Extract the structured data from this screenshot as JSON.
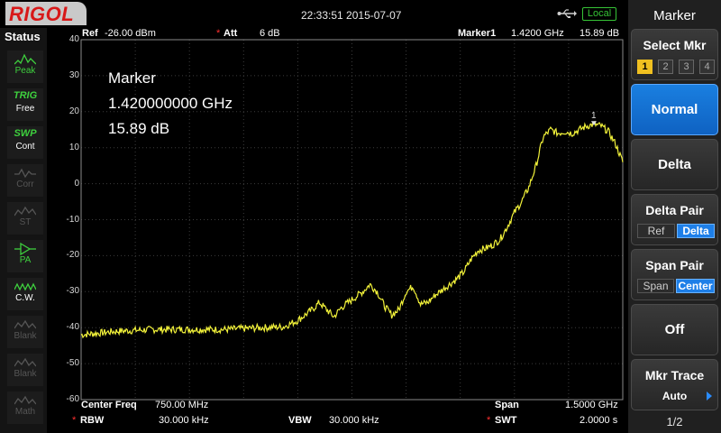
{
  "topbar": {
    "brand": "RIGOL",
    "datetime": "22:33:51  2015-07-07",
    "usb_icon": "usb-icon",
    "local_label": "Local",
    "local_color": "#36c436"
  },
  "status": {
    "title": "Status",
    "items": [
      {
        "glyph": "",
        "label": "Peak",
        "icon": "peak-icon",
        "state": "on"
      },
      {
        "glyph": "TRIG",
        "label": "Free",
        "icon": "",
        "state": "on"
      },
      {
        "glyph": "SWP",
        "label": "Cont",
        "icon": "",
        "state": "on"
      },
      {
        "glyph": "",
        "label": "Corr",
        "icon": "corr-icon",
        "state": "off"
      },
      {
        "glyph": "",
        "label": "ST",
        "icon": "st-icon",
        "state": "off"
      },
      {
        "glyph": "",
        "label": "PA",
        "icon": "pa-icon",
        "state": "on"
      },
      {
        "glyph": "",
        "label": "C.W.",
        "icon": "cw-icon",
        "state": "on"
      },
      {
        "glyph": "",
        "label": "Blank",
        "icon": "blank-icon",
        "state": "off"
      },
      {
        "glyph": "",
        "label": "Blank",
        "icon": "blank-icon",
        "state": "off"
      },
      {
        "glyph": "",
        "label": "Math",
        "icon": "math-icon",
        "state": "off"
      }
    ]
  },
  "header": {
    "ref_label": "Ref",
    "ref_value": "-26.00 dBm",
    "att_star": "*",
    "att_label": "Att",
    "att_value": "6 dB",
    "marker_label": "Marker1",
    "marker_freq": "1.4200 GHz",
    "marker_amp": "15.89 dB"
  },
  "marker_readout": {
    "title": "Marker",
    "freq": "1.420000000 GHz",
    "amp": "15.89 dB"
  },
  "footer": {
    "center_label": "Center Freq",
    "center_value": "750.00 MHz",
    "span_label": "Span",
    "span_value": "1.5000 GHz",
    "rbw_star": "*",
    "rbw_label": "RBW",
    "rbw_value": "30.000 kHz",
    "vbw_label": "VBW",
    "vbw_value": "30.000 kHz",
    "swt_star": "*",
    "swt_label": "SWT",
    "swt_value": "2.0000 s"
  },
  "menu": {
    "title": "Marker",
    "select_mkr_label": "Select Mkr",
    "mkr_numbers": [
      "1",
      "2",
      "3",
      "4"
    ],
    "mkr_active": "1",
    "normal_label": "Normal",
    "delta_label": "Delta",
    "delta_pair_label": "Delta Pair",
    "delta_pair_ref": "Ref",
    "delta_pair_delta": "Delta",
    "span_pair_label": "Span Pair",
    "span_pair_span": "Span",
    "span_pair_center": "Center",
    "off_label": "Off",
    "mkr_trace_label": "Mkr Trace",
    "mkr_trace_value": "Auto",
    "page": "1/2",
    "accent": "#1e7fe8"
  },
  "chart_data": {
    "type": "line",
    "ylim": [
      -60,
      40
    ],
    "yticks": [
      "40",
      "30",
      "20",
      "10",
      "0",
      "-10",
      "-20",
      "-30",
      "-40",
      "-50",
      "-60"
    ],
    "x_range_ghz": [
      0.0,
      1.5
    ],
    "grid": true,
    "trace_color": "#f2f23a",
    "marker": {
      "label": "1",
      "x": 1.42,
      "y": 15.89
    },
    "series": [
      {
        "x": [
          0.0,
          0.05,
          0.1,
          0.2,
          0.3,
          0.4,
          0.5,
          0.56,
          0.6,
          0.62,
          0.64,
          0.66,
          0.7,
          0.72,
          0.74,
          0.76,
          0.78,
          0.8,
          0.82,
          0.84,
          0.86,
          0.88,
          0.9,
          0.92,
          0.94,
          0.96,
          0.98,
          1.0,
          1.02,
          1.04,
          1.06,
          1.08,
          1.1,
          1.12,
          1.14,
          1.16,
          1.18,
          1.2,
          1.22,
          1.24,
          1.26,
          1.28,
          1.3,
          1.32,
          1.34,
          1.36,
          1.38,
          1.4,
          1.42,
          1.44,
          1.46,
          1.48,
          1.5
        ],
        "y": [
          -42,
          -41.5,
          -41,
          -40.5,
          -40.5,
          -40.5,
          -40,
          -39.8,
          -38,
          -36.5,
          -35,
          -33,
          -37,
          -34.5,
          -33,
          -31.5,
          -30,
          -28,
          -30,
          -34,
          -36.5,
          -35,
          -30,
          -28.5,
          -33.5,
          -33,
          -31,
          -29.5,
          -28,
          -26.5,
          -24.5,
          -21,
          -18.5,
          -18,
          -17,
          -15.5,
          -12,
          -8,
          -5,
          -1,
          5,
          13,
          15,
          14,
          14.5,
          14,
          15,
          16,
          16.5,
          16,
          14.5,
          11,
          6
        ]
      }
    ]
  }
}
